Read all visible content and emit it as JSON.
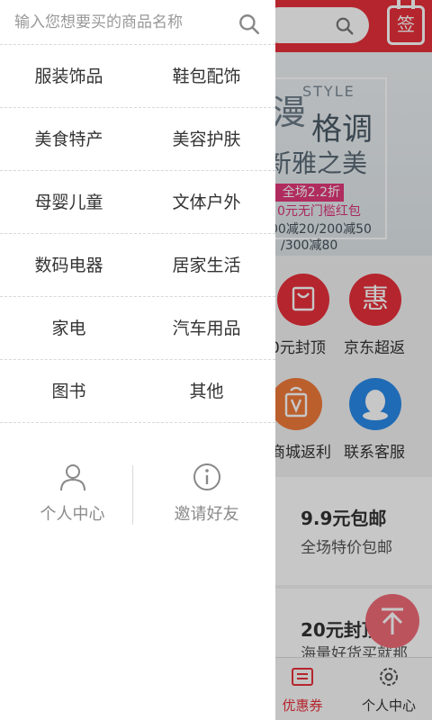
{
  "drawer": {
    "search": {
      "placeholder": "输入您想要买的商品名称"
    },
    "categories": [
      [
        "服装饰品",
        "鞋包配饰"
      ],
      [
        "美食特产",
        "美容护肤"
      ],
      [
        "母婴儿童",
        "文体户外"
      ],
      [
        "数码电器",
        "居家生活"
      ],
      [
        "家电",
        "汽车用品"
      ],
      [
        "图书",
        "其他"
      ]
    ],
    "bottom": {
      "profile_label": "个人中心",
      "invite_label": "邀请好友"
    }
  },
  "background": {
    "sign_label": "签",
    "banner": {
      "style_text": "STYLE",
      "big_char": "漫",
      "gediao": "格调",
      "xinyazhimei": "新雅之美",
      "discount": "全场2.2折起",
      "hongbao": "0元无门槛红包",
      "jian1": "00减20/200减50",
      "jian2": "/300减80"
    },
    "shortcuts": [
      {
        "label": "0元封顶",
        "color": "#e8303a",
        "icon": "bag-icon"
      },
      {
        "label": "京东超返",
        "color": "#e8303a",
        "icon": "hui-icon",
        "glyph": "惠"
      },
      {
        "label": "商城返利",
        "color": "#f07a3a",
        "icon": "v-bag-icon"
      },
      {
        "label": "联系客服",
        "color": "#2a8ae8",
        "icon": "qq-icon"
      }
    ],
    "promos": [
      {
        "title": "9.9元包邮",
        "subtitle": "全场特价包邮"
      },
      {
        "title": "20元封顶",
        "subtitle": "海量好货买就那"
      }
    ],
    "fab_icon": "arrow-up-icon",
    "tabs": [
      {
        "label": "优惠券",
        "icon": "coupon-icon",
        "active": true
      },
      {
        "label": "个人中心",
        "icon": "gear-icon",
        "active": false
      }
    ],
    "colors": {
      "brand": "#e8303a",
      "fab": "#f06b78"
    }
  }
}
